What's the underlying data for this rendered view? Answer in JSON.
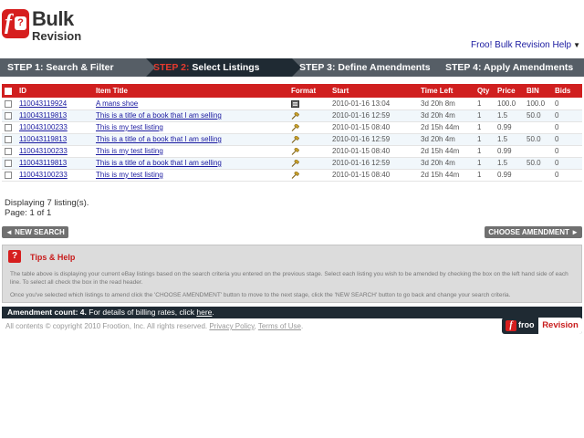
{
  "logo": {
    "line1": "Bulk",
    "line2": "Revision",
    "glyph_f": "f",
    "glyph_q": "?"
  },
  "help": {
    "label": "Froo! Bulk Revision Help",
    "arrow": "▼"
  },
  "steps": [
    {
      "num": "STEP 1:",
      "label": "Search & Filter",
      "active": false
    },
    {
      "num": "STEP 2:",
      "label": "Select Listings",
      "active": true
    },
    {
      "num": "STEP 3:",
      "label": "Define Amendments",
      "active": false
    },
    {
      "num": "STEP 4:",
      "label": "Apply Amendments",
      "active": false
    }
  ],
  "table": {
    "headers": [
      "ID",
      "Item Title",
      "Format",
      "Start",
      "Time Left",
      "Qty",
      "Price",
      "BIN",
      "Bids"
    ],
    "rows": [
      {
        "id": "110043119924",
        "title": "A mans shoe",
        "format": "store-icon",
        "start": "2010-01-16 13:04",
        "time_left": "3d 20h 8m",
        "qty": "1",
        "price": "100.0",
        "bin": "100.0",
        "bids": "0"
      },
      {
        "id": "110043119813",
        "title": "This is a title of a book that I am selling",
        "format": "gavel-icon",
        "start": "2010-01-16 12:59",
        "time_left": "3d 20h 4m",
        "qty": "1",
        "price": "1.5",
        "bin": "50.0",
        "bids": "0"
      },
      {
        "id": "110043100233",
        "title": "This is my test listing",
        "format": "gavel-icon",
        "start": "2010-01-15 08:40",
        "time_left": "2d 15h 44m",
        "qty": "1",
        "price": "0.99",
        "bin": "",
        "bids": "0"
      },
      {
        "id": "110043119813",
        "title": "This is a title of a book that I am selling",
        "format": "gavel-icon",
        "start": "2010-01-16 12:59",
        "time_left": "3d 20h 4m",
        "qty": "1",
        "price": "1.5",
        "bin": "50.0",
        "bids": "0"
      },
      {
        "id": "110043100233",
        "title": "This is my test listing",
        "format": "gavel-icon",
        "start": "2010-01-15 08:40",
        "time_left": "2d 15h 44m",
        "qty": "1",
        "price": "0.99",
        "bin": "",
        "bids": "0"
      },
      {
        "id": "110043119813",
        "title": "This is a title of a book that I am selling",
        "format": "gavel-icon",
        "start": "2010-01-16 12:59",
        "time_left": "3d 20h 4m",
        "qty": "1",
        "price": "1.5",
        "bin": "50.0",
        "bids": "0"
      },
      {
        "id": "110043100233",
        "title": "This is my test listing",
        "format": "gavel-icon",
        "start": "2010-01-15 08:40",
        "time_left": "2d 15h 44m",
        "qty": "1",
        "price": "0.99",
        "bin": "",
        "bids": "0"
      }
    ]
  },
  "info": {
    "displaying": "Displaying 7 listing(s).",
    "page": "Page: 1 of 1"
  },
  "buttons": {
    "new_search": "◄ NEW SEARCH",
    "choose": "CHOOSE AMENDMENT ►"
  },
  "tips": {
    "title": "Tips & Help",
    "icon": "?",
    "p1": "The table above is displaying your current eBay listings based on the search criteria you entered on the previous stage. Select each listing you wish to be amended by checking the box on the left hand side of each line. To select all check the box in the read header.",
    "p2": "Once you've selected which listings to amend click the 'CHOOSE AMENDMENT' button to move to the next stage, click the 'NEW SEARCH' button to go back and change your search criteria."
  },
  "amend": {
    "count": "Amendment count: 4.",
    "text": " For details of billing rates, click ",
    "link": "here",
    "end": "."
  },
  "footer": {
    "copyright": "All contents © copyright 2010 Frootion, Inc. All rights reserved. ",
    "privacy": "Privacy Policy",
    "sep": ", ",
    "terms": "Terms of Use",
    "end": "."
  },
  "brand": {
    "glyph": "f",
    "froo": "froo",
    "revision": "Revision"
  },
  "colors": {
    "accent_red": "#d01f1f",
    "dark_bar": "#1f2a33",
    "step_grey": "#565e66",
    "link_blue": "#1a1aa0"
  }
}
